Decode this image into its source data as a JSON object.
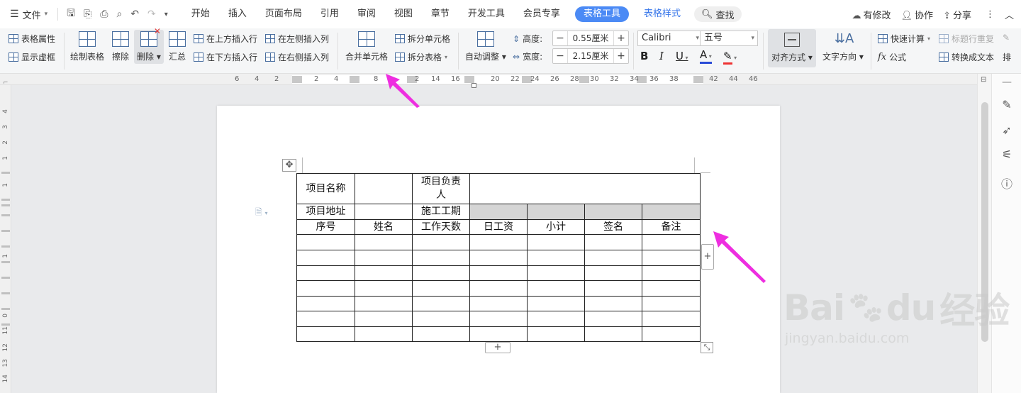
{
  "menubar": {
    "file_label": "文件",
    "tabs": [
      "开始",
      "插入",
      "页面布局",
      "引用",
      "审阅",
      "视图",
      "章节",
      "开发工具",
      "会员专享"
    ],
    "active_tab": "表格工具",
    "style_tab": "表格样式",
    "search_label": "查找",
    "right": {
      "modified": "有修改",
      "collab": "协作",
      "share": "分享"
    }
  },
  "ribbon": {
    "table_props": "表格属性",
    "show_grid": "显示虚框",
    "draw_table": "绘制表格",
    "erase": "擦除",
    "delete": "删除",
    "summary": "汇总",
    "insert_above": "在上方插入行",
    "insert_below": "在下方插入行",
    "insert_left": "在左侧插入列",
    "insert_right": "在右侧插入列",
    "merge_cells": "合并单元格",
    "split_cells": "拆分单元格",
    "split_table": "拆分表格",
    "auto_fit": "自动调整",
    "height_label": "高度:",
    "height_value": "0.55厘米",
    "width_label": "宽度:",
    "width_value": "2.15厘米",
    "font_name": "Calibri",
    "font_size": "五号",
    "align": "对齐方式",
    "text_dir": "文字方向",
    "quick_calc": "快速计算",
    "title_repeat": "标题行重复",
    "formula": "公式",
    "to_text": "转换成文本",
    "sort_partial": "排"
  },
  "ruler": {
    "h_ticks": [
      "6",
      "4",
      "2",
      "2",
      "4",
      "8",
      "2",
      "14",
      "16",
      "20",
      "22",
      "24",
      "26",
      "28",
      "30",
      "32",
      "34",
      "36",
      "38",
      "42",
      "44",
      "46"
    ],
    "v_ticks": [
      "4",
      "3",
      "2",
      "1",
      "1",
      "1",
      "0",
      "11",
      "12",
      "13",
      "14"
    ]
  },
  "table": {
    "rows": [
      [
        {
          "t": "项目名称"
        },
        {
          "t": ""
        },
        {
          "t": "项目负责人"
        },
        {
          "t": "",
          "colspan": 4
        }
      ],
      [
        {
          "t": "项目地址"
        },
        {
          "t": ""
        },
        {
          "t": "施工工期"
        },
        {
          "t": "",
          "shade": true
        },
        {
          "t": "",
          "shade": true
        },
        {
          "t": "",
          "shade": true
        },
        {
          "t": "",
          "shade": true
        }
      ],
      [
        {
          "t": "序号"
        },
        {
          "t": "姓名"
        },
        {
          "t": "工作天数"
        },
        {
          "t": "日工资"
        },
        {
          "t": "小计"
        },
        {
          "t": "签名"
        },
        {
          "t": "备注"
        }
      ],
      [
        {
          "t": ""
        },
        {
          "t": ""
        },
        {
          "t": ""
        },
        {
          "t": ""
        },
        {
          "t": ""
        },
        {
          "t": ""
        },
        {
          "t": ""
        }
      ],
      [
        {
          "t": ""
        },
        {
          "t": ""
        },
        {
          "t": ""
        },
        {
          "t": ""
        },
        {
          "t": ""
        },
        {
          "t": ""
        },
        {
          "t": ""
        }
      ],
      [
        {
          "t": ""
        },
        {
          "t": ""
        },
        {
          "t": ""
        },
        {
          "t": ""
        },
        {
          "t": ""
        },
        {
          "t": ""
        },
        {
          "t": ""
        }
      ],
      [
        {
          "t": ""
        },
        {
          "t": ""
        },
        {
          "t": ""
        },
        {
          "t": ""
        },
        {
          "t": ""
        },
        {
          "t": ""
        },
        {
          "t": ""
        }
      ],
      [
        {
          "t": ""
        },
        {
          "t": ""
        },
        {
          "t": ""
        },
        {
          "t": ""
        },
        {
          "t": ""
        },
        {
          "t": ""
        },
        {
          "t": ""
        }
      ],
      [
        {
          "t": ""
        },
        {
          "t": ""
        },
        {
          "t": ""
        },
        {
          "t": ""
        },
        {
          "t": ""
        },
        {
          "t": ""
        },
        {
          "t": ""
        }
      ],
      [
        {
          "t": ""
        },
        {
          "t": ""
        },
        {
          "t": ""
        },
        {
          "t": ""
        },
        {
          "t": ""
        },
        {
          "t": ""
        },
        {
          "t": ""
        }
      ]
    ]
  },
  "icons": {
    "menu": "hamburger-icon",
    "search": "search-icon",
    "move": "move-icon",
    "add": "plus-icon",
    "resize": "resize-icon"
  },
  "colors": {
    "accent": "#4b8af5",
    "annotation_arrow": "#ee2ee0",
    "shade": "#d5d5d5"
  },
  "watermark": {
    "brand": "Bai",
    "brand2": "du",
    "cn": "经验",
    "url": "jingyan.baidu.com"
  }
}
